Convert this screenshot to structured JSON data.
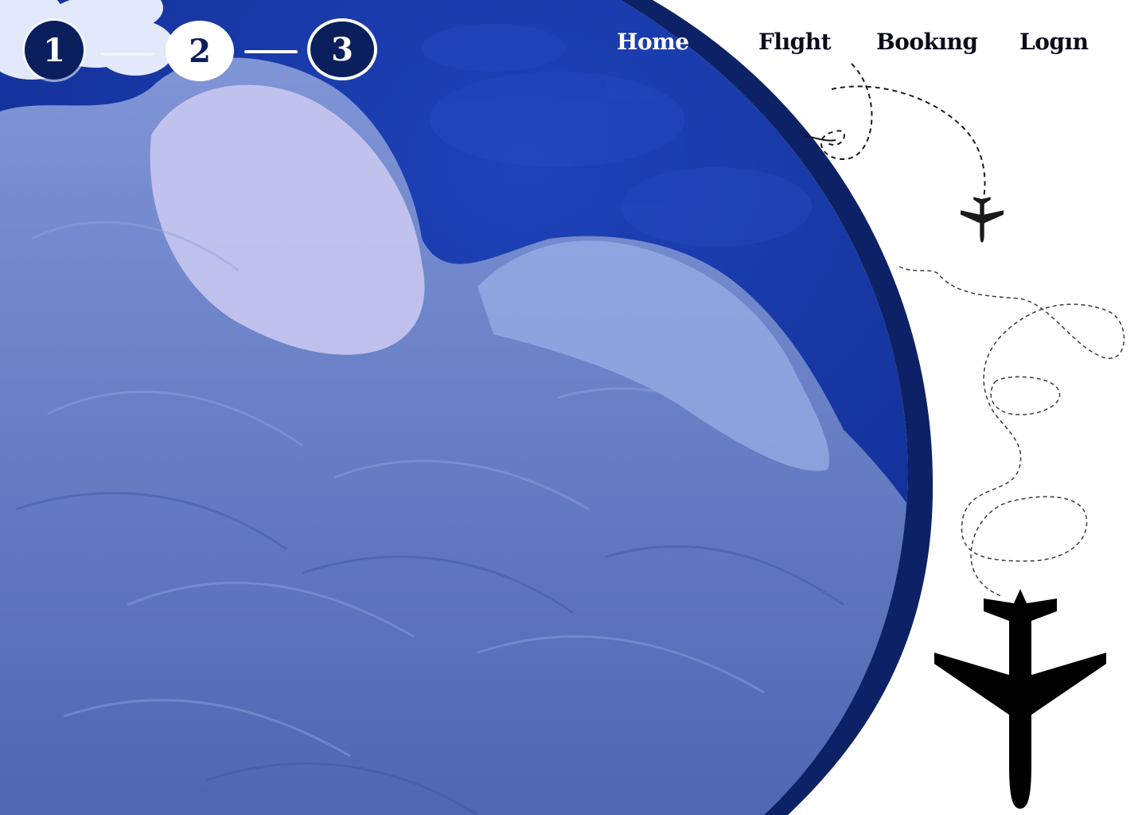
{
  "steps": [
    {
      "label": "1",
      "state": "completed"
    },
    {
      "label": "2",
      "state": "completed"
    },
    {
      "label": "3",
      "state": "current"
    }
  ],
  "nav": {
    "home": "Home",
    "flight": "Flıght",
    "booking": "Bookıng",
    "login": "Logın"
  },
  "colors": {
    "navy": "#0b1f5c",
    "sky": "#1a3aa8",
    "cloud": "#6f86c9",
    "cloud_light": "#c9c6ef",
    "frame": "#0d2266"
  },
  "icons": {
    "small_plane": "airplane-icon",
    "large_plane": "airplane-icon"
  }
}
